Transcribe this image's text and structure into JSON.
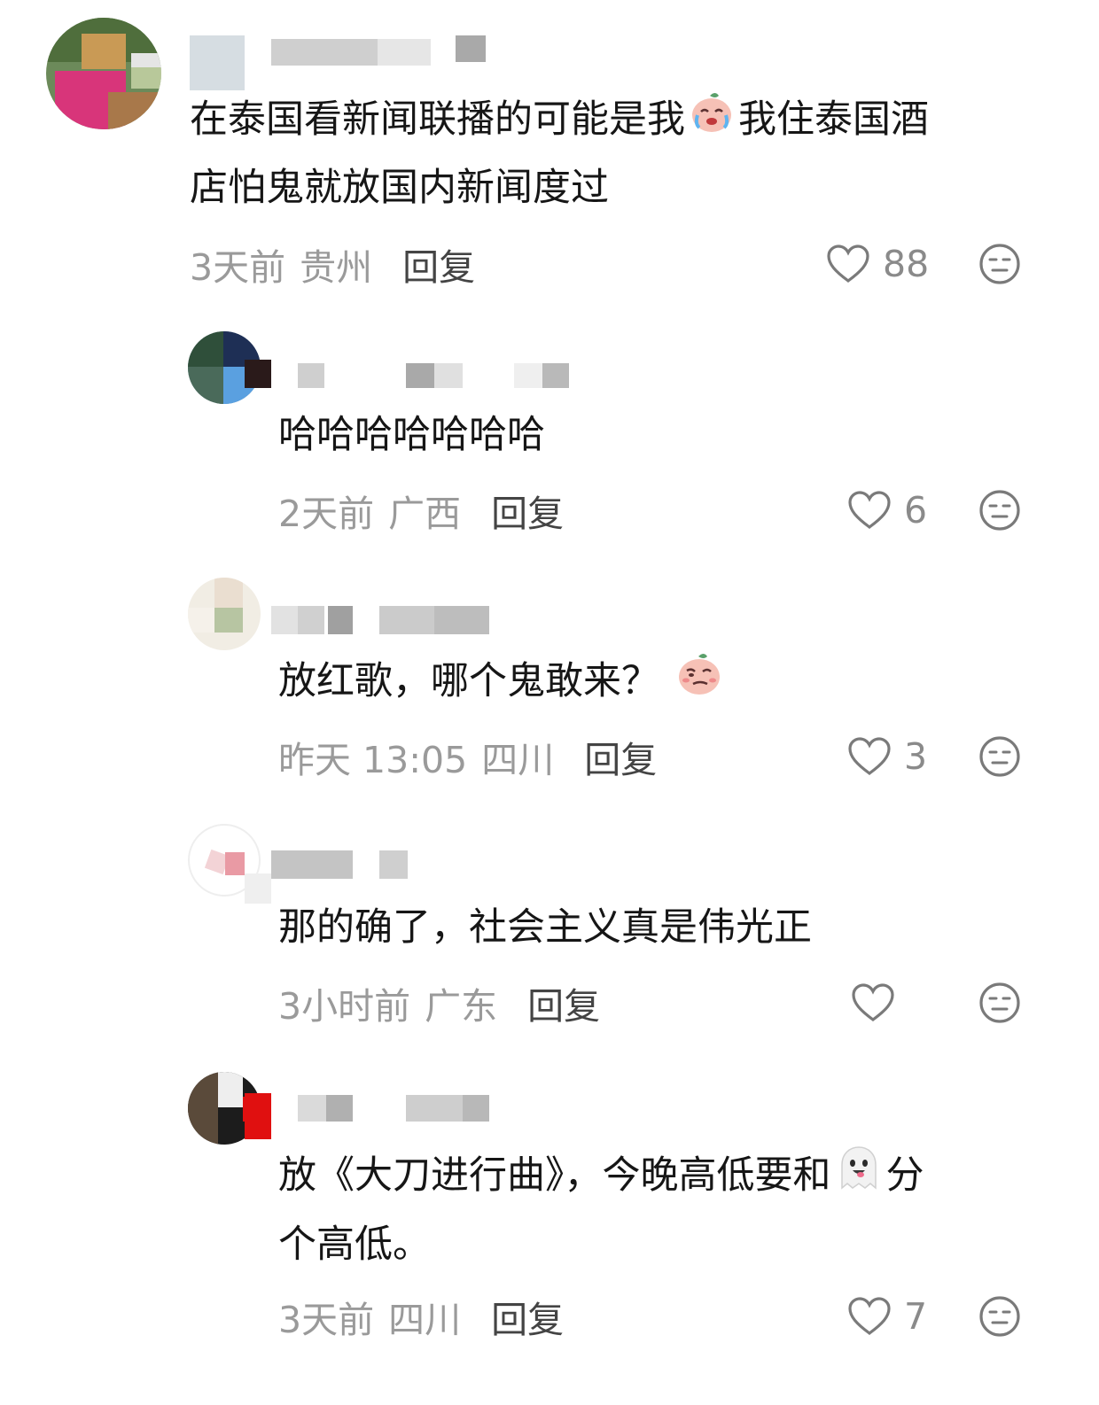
{
  "comments": [
    {
      "text_part1": "在泰国看新闻联播的可能是我",
      "emoji_mid": "crying-peach-emoji",
      "text_part2": "我住泰国酒",
      "text_line2": "店怕鬼就放国内新闻度过",
      "time": "3天前",
      "location": "贵州",
      "reply_label": "回复",
      "likes": "88"
    },
    {
      "text": "哈哈哈哈哈哈哈",
      "time": "2天前",
      "location": "广西",
      "reply_label": "回复",
      "likes": "6"
    },
    {
      "text": "放红歌，哪个鬼敢来？",
      "emoji_end": "smirking-peach-emoji",
      "time": "昨天 13:05",
      "location": "四川",
      "reply_label": "回复",
      "likes": "3"
    },
    {
      "text": "那的确了，社会主义真是伟光正",
      "time": "3小时前",
      "location": "广东",
      "reply_label": "回复",
      "likes": ""
    },
    {
      "text_part1": "放《大刀进行曲》，今晚高低要和",
      "emoji_mid": "ghost-emoji",
      "text_part2": "分",
      "text_line2": "个高低。",
      "time": "3天前",
      "location": "四川",
      "reply_label": "回复",
      "likes": "7"
    }
  ],
  "colors": {
    "text": "#161616",
    "meta": "#9a9a9a",
    "reply": "#444444",
    "icon": "#7a7a7a"
  }
}
